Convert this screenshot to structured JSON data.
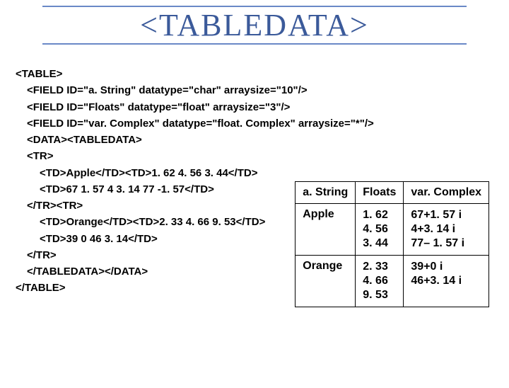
{
  "title": "<TABLEDATA>",
  "code": {
    "l1": "<TABLE>",
    "l2": "<FIELD ID=\"a. String\" datatype=\"char\" arraysize=\"10\"/>",
    "l3": "<FIELD ID=\"Floats\" datatype=\"float\" arraysize=\"3\"/>",
    "l4": "<FIELD ID=\"var. Complex\" datatype=\"float. Complex\" arraysize=\"*\"/>",
    "l5": "<DATA><TABLEDATA>",
    "l6": "<TR>",
    "l7": "<TD>Apple</TD><TD>1. 62 4. 56 3. 44</TD>",
    "l8": "<TD>67 1. 57 4 3. 14 77 -1. 57</TD>",
    "l9": "</TR><TR>",
    "l10": "<TD>Orange</TD><TD>2. 33 4. 66 9. 53</TD>",
    "l11": "<TD>39 0 46 3. 14</TD>",
    "l12": "</TR>",
    "l13": "</TABLEDATA></DATA>",
    "l14": "</TABLE>"
  },
  "table": {
    "headers": {
      "c1": "a. String",
      "c2": "Floats",
      "c3": "var. Complex"
    },
    "rows": [
      {
        "c1": "Apple",
        "c2": "1. 62\n4. 56\n3. 44",
        "c3": "67+1. 57 i\n4+3. 14 i\n77– 1. 57 i"
      },
      {
        "c1": "Orange",
        "c2": "2. 33\n4. 66\n9. 53",
        "c3": "39+0 i\n46+3. 14 i"
      }
    ]
  }
}
